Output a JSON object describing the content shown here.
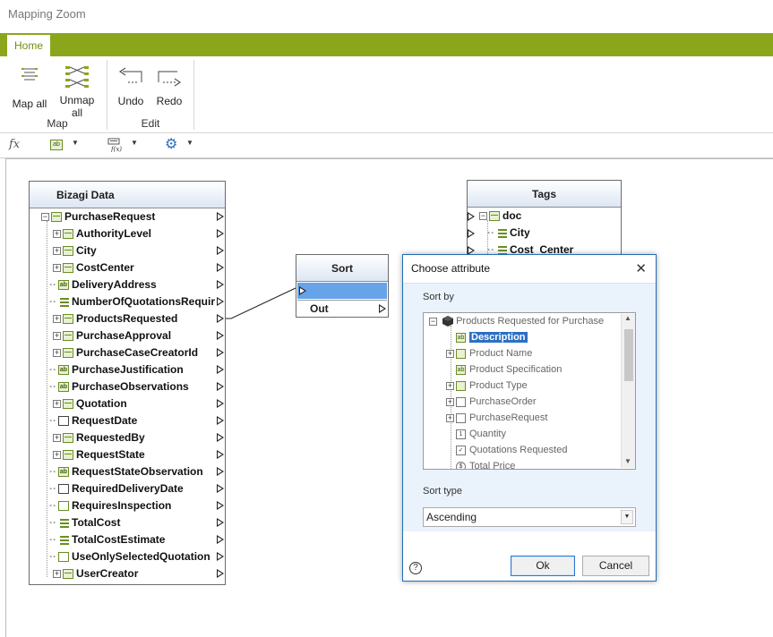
{
  "window": {
    "title": "Mapping Zoom"
  },
  "ribbon": {
    "tabs": [
      {
        "label": "Home"
      }
    ],
    "groups": [
      {
        "label": "Map",
        "buttons": [
          {
            "label": "Map all",
            "icon": "map-all-icon"
          },
          {
            "label": "Unmap all",
            "icon": "unmap-all-icon"
          }
        ]
      },
      {
        "label": "Edit",
        "buttons": [
          {
            "label": "Undo",
            "icon": "undo-icon"
          },
          {
            "label": "Redo",
            "icon": "redo-icon"
          }
        ]
      }
    ]
  },
  "formula_bar": {
    "fx_label": "fx",
    "tools": [
      "text-function-icon",
      "formula-function-icon",
      "settings-gear-icon"
    ]
  },
  "bizagi_panel": {
    "title": "Bizagi Data",
    "root": "PurchaseRequest",
    "items": [
      {
        "label": "AuthorityLevel",
        "icon": "table",
        "expandable": true
      },
      {
        "label": "City",
        "icon": "table",
        "expandable": true
      },
      {
        "label": "CostCenter",
        "icon": "table",
        "expandable": true
      },
      {
        "label": "DeliveryAddress",
        "icon": "text",
        "expandable": false
      },
      {
        "label": "NumberOfQuotationsRequir",
        "icon": "list",
        "expandable": false
      },
      {
        "label": "ProductsRequested",
        "icon": "table",
        "expandable": true
      },
      {
        "label": "PurchaseApproval",
        "icon": "table",
        "expandable": true
      },
      {
        "label": "PurchaseCaseCreatorId",
        "icon": "table",
        "expandable": true
      },
      {
        "label": "PurchaseJustification",
        "icon": "text",
        "expandable": false
      },
      {
        "label": "PurchaseObservations",
        "icon": "text",
        "expandable": false
      },
      {
        "label": "Quotation",
        "icon": "table",
        "expandable": true
      },
      {
        "label": "RequestDate",
        "icon": "date",
        "expandable": false
      },
      {
        "label": "RequestedBy",
        "icon": "table",
        "expandable": true
      },
      {
        "label": "RequestState",
        "icon": "table",
        "expandable": true
      },
      {
        "label": "RequestStateObservation",
        "icon": "text",
        "expandable": false
      },
      {
        "label": "RequiredDeliveryDate",
        "icon": "date",
        "expandable": false
      },
      {
        "label": "RequiresInspection",
        "icon": "check",
        "expandable": false
      },
      {
        "label": "TotalCost",
        "icon": "list",
        "expandable": false
      },
      {
        "label": "TotalCostEstimate",
        "icon": "list",
        "expandable": false
      },
      {
        "label": "UseOnlySelectedQuotation",
        "icon": "check",
        "expandable": false
      },
      {
        "label": "UserCreator",
        "icon": "table",
        "expandable": true
      }
    ]
  },
  "sort_node": {
    "title": "Sort",
    "out_label": "Out"
  },
  "tags_panel": {
    "title": "Tags",
    "root": "doc",
    "items": [
      "City",
      "Cost_Center"
    ]
  },
  "dialog": {
    "title": "Choose attribute",
    "close_icon": "close-icon",
    "sort_by_label": "Sort by",
    "tree_root": "Products Requested for Purchase",
    "tree_items": [
      {
        "label": "Description",
        "icon": "text",
        "expandable": false,
        "selected": true
      },
      {
        "label": "Product Name",
        "icon": "table",
        "expandable": true
      },
      {
        "label": "Product Specification",
        "icon": "text",
        "expandable": false
      },
      {
        "label": "Product Type",
        "icon": "table",
        "expandable": true
      },
      {
        "label": "PurchaseOrder",
        "icon": "entity",
        "expandable": true
      },
      {
        "label": "PurchaseRequest",
        "icon": "entity",
        "expandable": true
      },
      {
        "label": "Quantity",
        "icon": "number",
        "expandable": false
      },
      {
        "label": "Quotations Requested",
        "icon": "check",
        "expandable": false
      },
      {
        "label": "Total Price",
        "icon": "currency",
        "expandable": false
      }
    ],
    "sort_type_label": "Sort type",
    "sort_type_value": "Ascending",
    "ok_label": "Ok",
    "cancel_label": "Cancel",
    "help_label": "?"
  }
}
